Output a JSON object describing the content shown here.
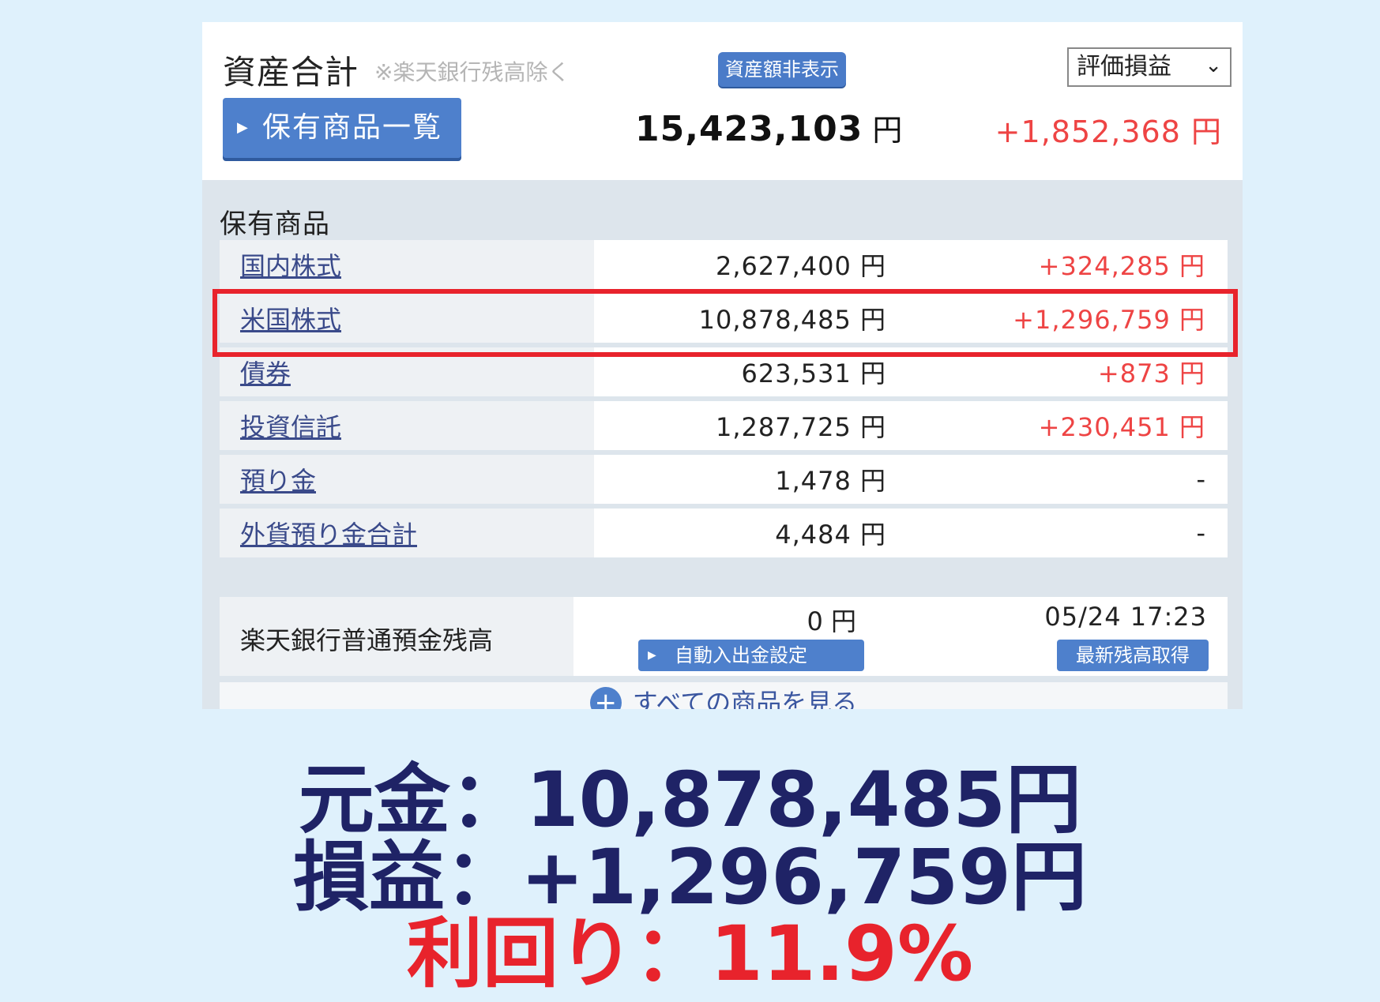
{
  "header": {
    "title": "資産合計",
    "title_note": "※楽天銀行残高除く",
    "hide_button": "資産額非表示",
    "select_value": "評価損益",
    "list_button": "保有商品一覧",
    "total_value": "15,423,103",
    "total_unit": "円",
    "total_gain": "+1,852,368 円"
  },
  "holdings": {
    "section_title": "保有商品",
    "rows": [
      {
        "name": "国内株式",
        "value": "2,627,400 円",
        "gain": "+324,285 円"
      },
      {
        "name": "米国株式",
        "value": "10,878,485 円",
        "gain": "+1,296,759 円"
      },
      {
        "name": "債券",
        "value": "623,531 円",
        "gain": "+873 円"
      },
      {
        "name": "投資信託",
        "value": "1,287,725 円",
        "gain": "+230,451 円"
      },
      {
        "name": "預り金",
        "value": "1,478 円",
        "gain": "-"
      },
      {
        "name": "外貨預り金合計",
        "value": "4,484 円",
        "gain": "-"
      }
    ],
    "bank": {
      "name": "楽天銀行普通預金残高",
      "value": "0 円",
      "auto_button": "自動入出金設定",
      "timestamp": "05/24 17:23",
      "refresh_button": "最新残高取得"
    },
    "see_all": "すべての商品を見る"
  },
  "summary": {
    "principal": "元金：10,878,485円",
    "profit": "損益：+1,296,759円",
    "yield": "利回り：11.9%"
  },
  "colors": {
    "accent_blue": "#4e80cc",
    "gain_red": "#ee4444",
    "highlight_red": "#e8232c",
    "summary_navy": "#1f2366",
    "background": "#dff1fc"
  }
}
